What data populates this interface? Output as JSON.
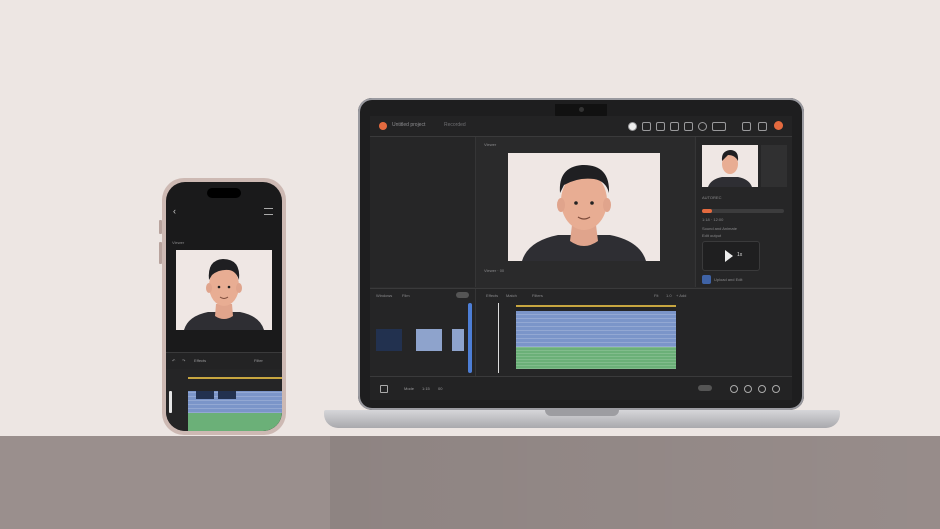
{
  "scene": {
    "description_colors": {
      "wall": "#ede6e3",
      "table": "#9a8f8d",
      "accent": "#e46a3f",
      "clip_blue": "#7b95c9",
      "clip_green": "#6bb078"
    }
  },
  "laptop_app": {
    "topbar": {
      "project": "Untitled project",
      "tab": "Recorded"
    },
    "viewer": {
      "label": "Viewer",
      "timecode": "Viewer  ·  00"
    },
    "right_panel": {
      "section1": "AUTOREC",
      "section2": "1:18  ·  12:00",
      "section3": "Sound and Animate",
      "section4": "Edit output",
      "badge_text": "Upload and Edit"
    },
    "play": {
      "speed": "1x"
    },
    "timeline": {
      "left_labels": [
        "Windows",
        "Film"
      ],
      "tabs": [
        "Effects",
        "Match",
        "Filters",
        "Fit",
        "1.0",
        "+ Add"
      ]
    },
    "bottombar": {
      "text1": "Mode",
      "text2": "1:15",
      "text3": "00"
    }
  },
  "phone_app": {
    "label": "Viewer",
    "controls": {
      "left": "Effects",
      "right": "Filter"
    }
  }
}
